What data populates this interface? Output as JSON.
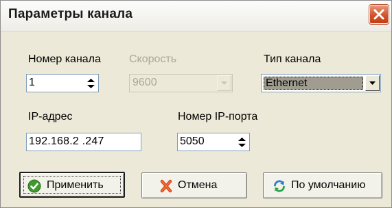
{
  "window": {
    "title": "Параметры канала",
    "close_icon": "close-icon"
  },
  "fields": {
    "channel_number": {
      "label": "Номер канала",
      "value": "1"
    },
    "speed": {
      "label": "Скорость",
      "value": "9600",
      "enabled": false
    },
    "channel_type": {
      "label": "Тип канала",
      "value": "Ethernet"
    },
    "ip_address": {
      "label": "IP-адрес",
      "value": "192.168.2 .247"
    },
    "ip_port": {
      "label": "Номер IP-порта",
      "value": "5050"
    }
  },
  "buttons": {
    "apply": {
      "label": "Применить",
      "icon": "check-icon"
    },
    "cancel": {
      "label": "Отмена",
      "icon": "cross-icon"
    },
    "defaults": {
      "label": "По умолчанию",
      "icon": "refresh-icon"
    }
  },
  "colors": {
    "dialog_bg": "#ece9d8",
    "close_button": "#d2532a",
    "combo_selection": "#a09c8f"
  }
}
